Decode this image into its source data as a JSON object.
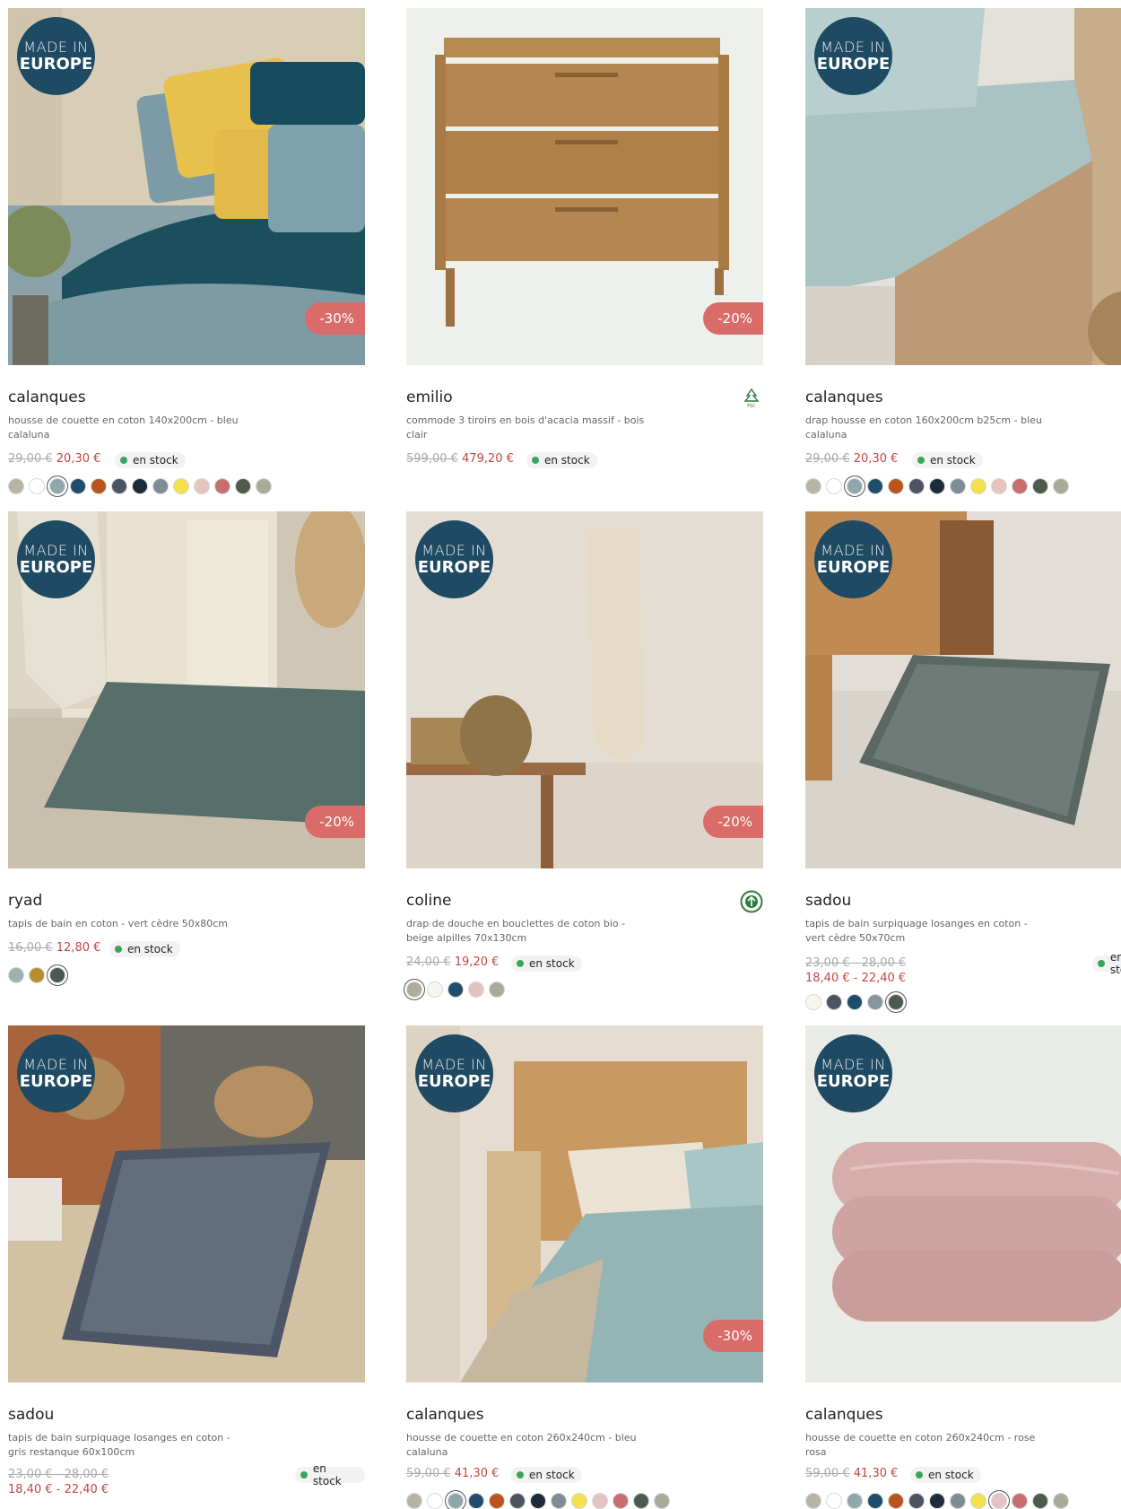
{
  "badge": {
    "line1": "MADE IN",
    "line2": "EUROPE"
  },
  "products": [
    {
      "name": "calanques",
      "desc": "housse de couette en coton 140x200cm - bleu calaluna",
      "old_price": "29,00 €",
      "new_price": "20,30 €",
      "stock": "en stock",
      "discount": "-30%",
      "made_in_europe": true,
      "label_icon": "",
      "swatches": [
        "#b7b4a5",
        "#ffffff",
        "#8fa7ab",
        "#1f4d6b",
        "#b9541e",
        "#4b5561",
        "#1d2b3b",
        "#7d8c95",
        "#f3e04c",
        "#e4c3c0",
        "#c76e70",
        "#4d5b4d",
        "#a7ab98"
      ],
      "selected": 2
    },
    {
      "name": "emilio",
      "desc": "commode 3 tiroirs en bois d'acacia massif - bois clair",
      "old_price": "599,00 €",
      "new_price": "479,20 €",
      "stock": "en stock",
      "discount": "-20%",
      "made_in_europe": false,
      "label_icon": "fsc-icon",
      "swatches": [],
      "selected": -1
    },
    {
      "name": "calanques",
      "desc": "drap housse en coton 160x200cm b25cm - bleu calaluna",
      "old_price": "29,00 €",
      "new_price": "20,30 €",
      "stock": "en stock",
      "discount": "",
      "made_in_europe": true,
      "label_icon": "",
      "swatches": [
        "#b7b4a5",
        "#ffffff",
        "#8fa7ab",
        "#1f4d6b",
        "#b9541e",
        "#4b5561",
        "#1d2b3b",
        "#7d8c95",
        "#f3e04c",
        "#e4c3c0",
        "#c76e70",
        "#4d5b4d",
        "#a7ab98"
      ],
      "selected": 2
    },
    {
      "name": "ryad",
      "desc": "tapis de bain en coton - vert cèdre 50x80cm",
      "old_price": "16,00 €",
      "new_price": "12,80 €",
      "stock": "en stock",
      "discount": "-20%",
      "made_in_europe": true,
      "label_icon": "",
      "swatches": [
        "#9fb0b3",
        "#b88d2c",
        "#4a5a4e"
      ],
      "selected": 2
    },
    {
      "name": "coline",
      "desc": "drap de douche en bouclettes de coton bio - beige alpilles 70x130cm",
      "old_price": "24,00 €",
      "new_price": "19,20 €",
      "stock": "en stock",
      "discount": "-20%",
      "made_in_europe": true,
      "label_icon": "bio-icon",
      "swatches": [
        "#b1ab9b",
        "#f8f6ee",
        "#1f4d6b",
        "#e1c2c0",
        "#a9ab98"
      ],
      "selected": 0
    },
    {
      "name": "sadou",
      "desc": "tapis de bain surpiquage losanges en coton - vert cèdre 50x70cm",
      "old_price": "23,00 € - 28,00 €",
      "new_price": "18,40 € - 22,40 €",
      "stock": "en stock",
      "discount": "",
      "made_in_europe": true,
      "label_icon": "",
      "swatches": [
        "#f8f6ee",
        "#4b5561",
        "#1f4d6b",
        "#8596a1",
        "#4a5a4e"
      ],
      "selected": 4
    },
    {
      "name": "sadou",
      "desc": "tapis de bain surpiquage losanges en coton - gris restanque 60x100cm",
      "old_price": "23,00 € - 28,00 €",
      "new_price": "18,40 € - 22,40 €",
      "stock": "en stock",
      "discount": "",
      "made_in_europe": true,
      "label_icon": "",
      "swatches": [],
      "selected": -1
    },
    {
      "name": "calanques",
      "desc": "housse de couette en coton 260x240cm - bleu calaluna",
      "old_price": "59,00 €",
      "new_price": "41,30 €",
      "stock": "en stock",
      "discount": "-30%",
      "made_in_europe": true,
      "label_icon": "",
      "swatches": [
        "#b7b4a5",
        "#ffffff",
        "#8fa7ab",
        "#1f4d6b",
        "#b9541e",
        "#4b5561",
        "#1d2b3b",
        "#7d8c95",
        "#f3e04c",
        "#e4c3c0",
        "#c76e70",
        "#4d5b4d",
        "#a7ab98"
      ],
      "selected": 2
    },
    {
      "name": "calanques",
      "desc": "housse de couette en coton 260x240cm - rose rosa",
      "old_price": "59,00 €",
      "new_price": "41,30 €",
      "stock": "en stock",
      "discount": "",
      "made_in_europe": true,
      "label_icon": "",
      "swatches": [
        "#b7b4a5",
        "#ffffff",
        "#8fa7ab",
        "#1f4d6b",
        "#b9541e",
        "#4b5561",
        "#1d2b3b",
        "#7d8c95",
        "#f3e04c",
        "#e4c3c0",
        "#c76e70",
        "#4d5b4d",
        "#a7ab98"
      ],
      "selected": 9
    }
  ],
  "colors": {
    "discount": "#d96b69",
    "new_price": "#c4473f",
    "badge": "#1f4a63",
    "in_stock": "#3aa55c"
  }
}
